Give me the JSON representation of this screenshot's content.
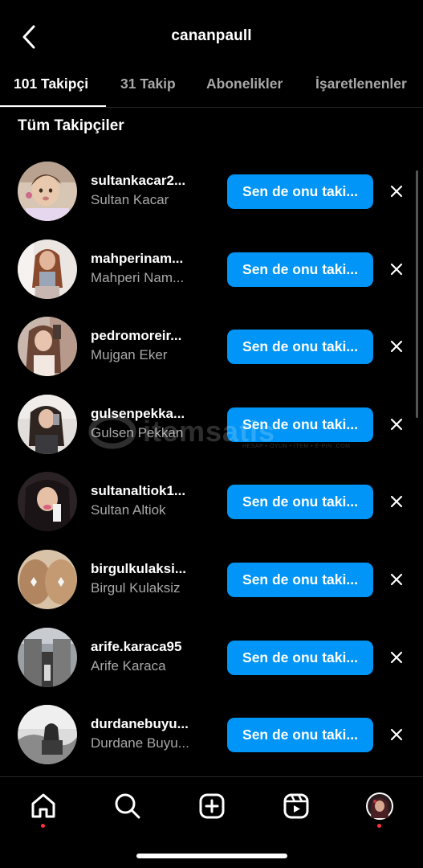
{
  "header": {
    "back_icon": "chevron-left-icon",
    "title": "cananpaull"
  },
  "tabs": [
    {
      "label": "101 Takipçi",
      "active": true
    },
    {
      "label": "31 Takip",
      "active": false
    },
    {
      "label": "Abonelikler",
      "active": false
    },
    {
      "label": "İşaretlenenler",
      "active": false
    }
  ],
  "section_title": "Tüm Takipçiler",
  "followers": [
    {
      "username": "sultankacar2...",
      "full_name": "Sultan Kacar",
      "button_label": "Sen de onu taki..."
    },
    {
      "username": "mahperinam...",
      "full_name": "Mahperi Nam...",
      "button_label": "Sen de onu taki..."
    },
    {
      "username": "pedromoreir...",
      "full_name": "Mujgan Eker",
      "button_label": "Sen de onu taki..."
    },
    {
      "username": "gulsenpekka...",
      "full_name": "Gulsen Pekkan",
      "button_label": "Sen de onu taki..."
    },
    {
      "username": "sultanaltiok1...",
      "full_name": "Sultan Altiok",
      "button_label": "Sen de onu taki..."
    },
    {
      "username": "birgulkulaksi...",
      "full_name": "Birgul Kulaksiz",
      "button_label": "Sen de onu taki..."
    },
    {
      "username": "arife.karaca95",
      "full_name": "Arife Karaca",
      "button_label": "Sen de onu taki..."
    },
    {
      "username": "durdanebuyu...",
      "full_name": "Durdane Buyu...",
      "button_label": "Sen de onu taki..."
    }
  ],
  "watermark": {
    "main": "itemsatis",
    "sub": "HESAP • OYUN • İTEM • E-PIN .COM"
  },
  "bottom_nav": [
    "home-icon",
    "search-icon",
    "create-icon",
    "reels-icon",
    "profile-avatar"
  ],
  "colors": {
    "accent": "#0095f6",
    "background": "#000000",
    "secondary_text": "#a8a8a8",
    "notification_dot": "#ff3040"
  }
}
